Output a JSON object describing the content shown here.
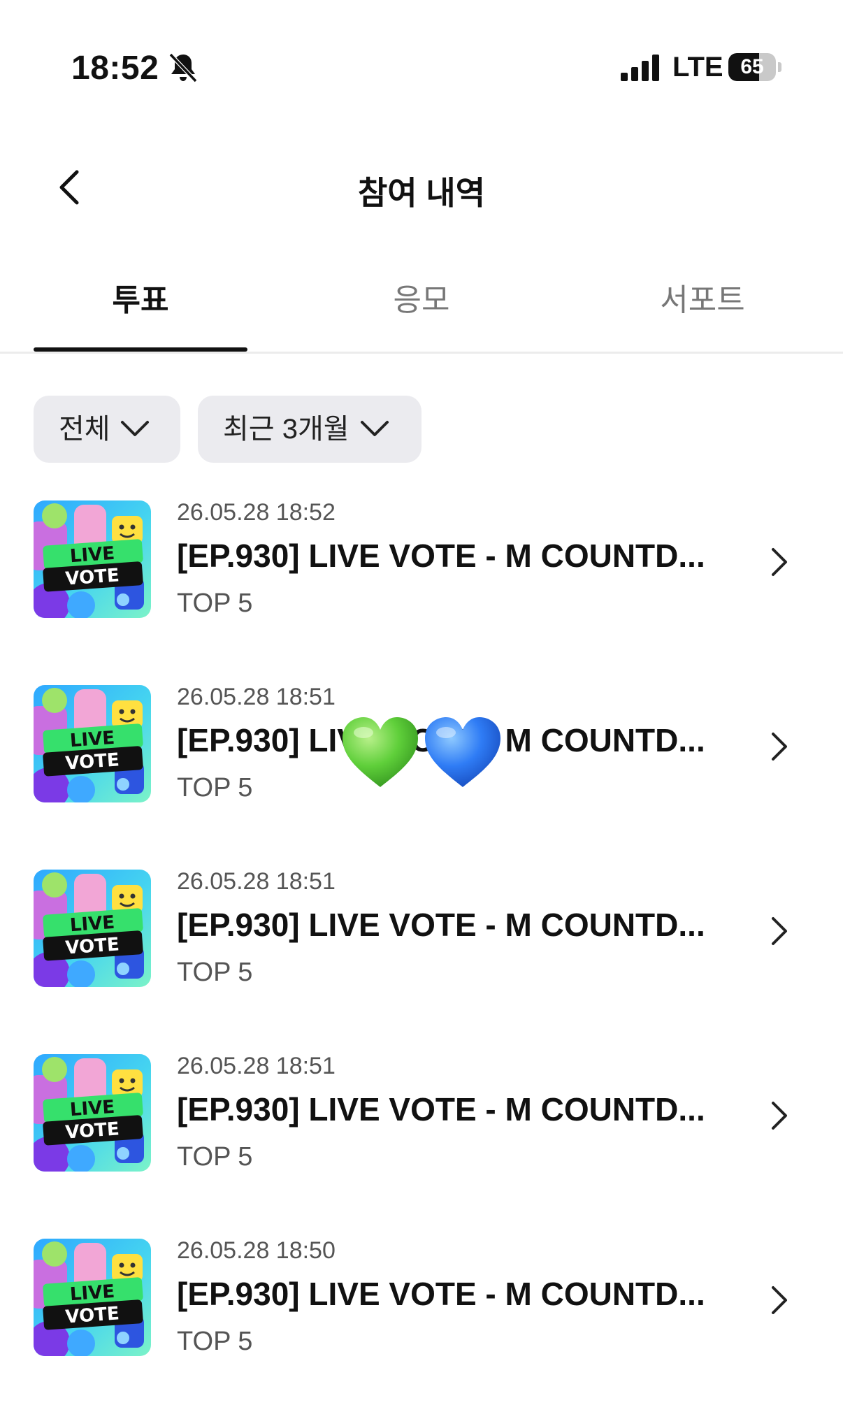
{
  "status_bar": {
    "time": "18:52",
    "network": "LTE",
    "battery_percent": 65
  },
  "header": {
    "title": "참여 내역"
  },
  "tabs": [
    {
      "label": "투표",
      "active": true
    },
    {
      "label": "응모",
      "active": false
    },
    {
      "label": "서포트",
      "active": false
    }
  ],
  "filters": [
    {
      "label": "전체"
    },
    {
      "label": "최근 3개월"
    }
  ],
  "thumbnail": {
    "line1": "LIVE",
    "line2": "VOTE"
  },
  "items": [
    {
      "date": "26.05.28 18:52",
      "title": "[EP.930] LIVE VOTE - M COUNTD...",
      "subtitle": "TOP 5"
    },
    {
      "date": "26.05.28 18:51",
      "title": "[EP.930] LIVE VOTE - M COUNTD...",
      "subtitle": "TOP 5"
    },
    {
      "date": "26.05.28 18:51",
      "title": "[EP.930] LIVE VOTE - M COUNTD...",
      "subtitle": "TOP 5"
    },
    {
      "date": "26.05.28 18:51",
      "title": "[EP.930] LIVE VOTE - M COUNTD...",
      "subtitle": "TOP 5"
    },
    {
      "date": "26.05.28 18:50",
      "title": "[EP.930] LIVE VOTE - M COUNTD...",
      "subtitle": "TOP 5"
    }
  ],
  "overlay": {
    "icons": [
      "green-heart",
      "blue-heart"
    ]
  }
}
